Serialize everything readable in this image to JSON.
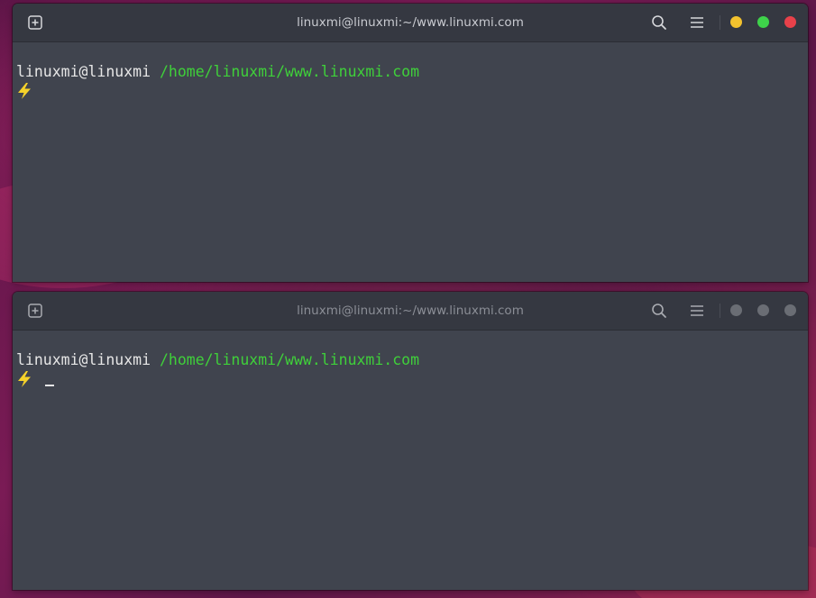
{
  "colors": {
    "terminal_bg": "#40444e",
    "titlebar_bg": "#353841",
    "path_green": "#3fd03a",
    "bolt_yellow": "#f5d22a",
    "btn_minimize_active": "#f3c22e",
    "btn_maximize_active": "#3ed24a",
    "btn_close_active": "#e8414a",
    "btn_inactive": "#6a6d74"
  },
  "windows": [
    {
      "state": "active",
      "title": "linuxmi@linuxmi:~/www.linuxmi.com",
      "prompt": {
        "user_host": "linuxmi@linuxmi",
        "path": "/home/linuxmi/www.linuxmi.com",
        "symbol_icon": "lightning-bolt-icon"
      },
      "show_cursor": false
    },
    {
      "state": "inactive",
      "title": "linuxmi@linuxmi:~/www.linuxmi.com",
      "prompt": {
        "user_host": "linuxmi@linuxmi",
        "path": "/home/linuxmi/www.linuxmi.com",
        "symbol_icon": "lightning-bolt-icon"
      },
      "show_cursor": true
    }
  ],
  "icons": {
    "new_tab": "new-tab-icon",
    "search": "search-icon",
    "menu": "hamburger-menu-icon",
    "minimize": "minimize-icon",
    "maximize": "maximize-icon",
    "close": "close-icon"
  }
}
